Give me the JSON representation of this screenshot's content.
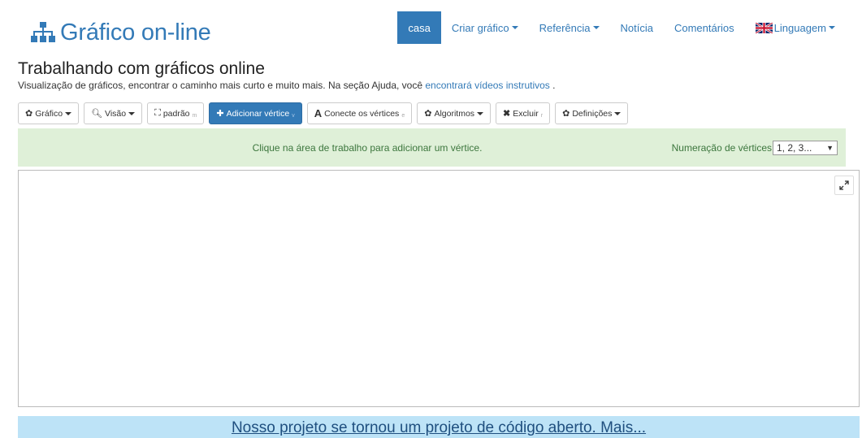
{
  "header": {
    "logo_text": "Gráfico on-line",
    "nav": [
      {
        "label": "casa",
        "active": true,
        "dropdown": false
      },
      {
        "label": "Criar gráfico",
        "dropdown": true
      },
      {
        "label": "Referência",
        "dropdown": true
      },
      {
        "label": "Notícia",
        "dropdown": false
      },
      {
        "label": "Comentários",
        "dropdown": false
      },
      {
        "label": "Linguagem",
        "dropdown": true,
        "icon": "uk-flag-icon"
      }
    ]
  },
  "page": {
    "title": "Trabalhando com gráficos online",
    "subtitle_prefix": "Visualização de gráficos, encontrar o caminho mais curto e muito mais. Na seção Ajuda, você ",
    "subtitle_link": "encontrará vídeos instrutivos",
    "subtitle_suffix": " ."
  },
  "toolbar": {
    "grafico": "Gráfico",
    "visao": "Visão",
    "padrao": "padrão",
    "padrao_hotkey": "m",
    "adicionar": "Adicionar vértice",
    "adicionar_hotkey": "v",
    "conecte": "Conecte os vértices",
    "conecte_hotkey": "e",
    "algoritmos": "Algoritmos",
    "excluir": "Excluir",
    "excluir_hotkey": "r",
    "definicoes": "Definições"
  },
  "infobar": {
    "message": "Clique na área de trabalho para adicionar um vértice.",
    "numbering_label": "Numeração de vértices",
    "numbering_value": "1, 2, 3..."
  },
  "banner": {
    "text": "Nosso projeto se tornou um projeto de código aberto. Mais..."
  },
  "colors": {
    "brand": "#337ab7",
    "info_bg": "#dff0d8",
    "info_text": "#3c763d",
    "banner_bg": "#bde3f7"
  }
}
